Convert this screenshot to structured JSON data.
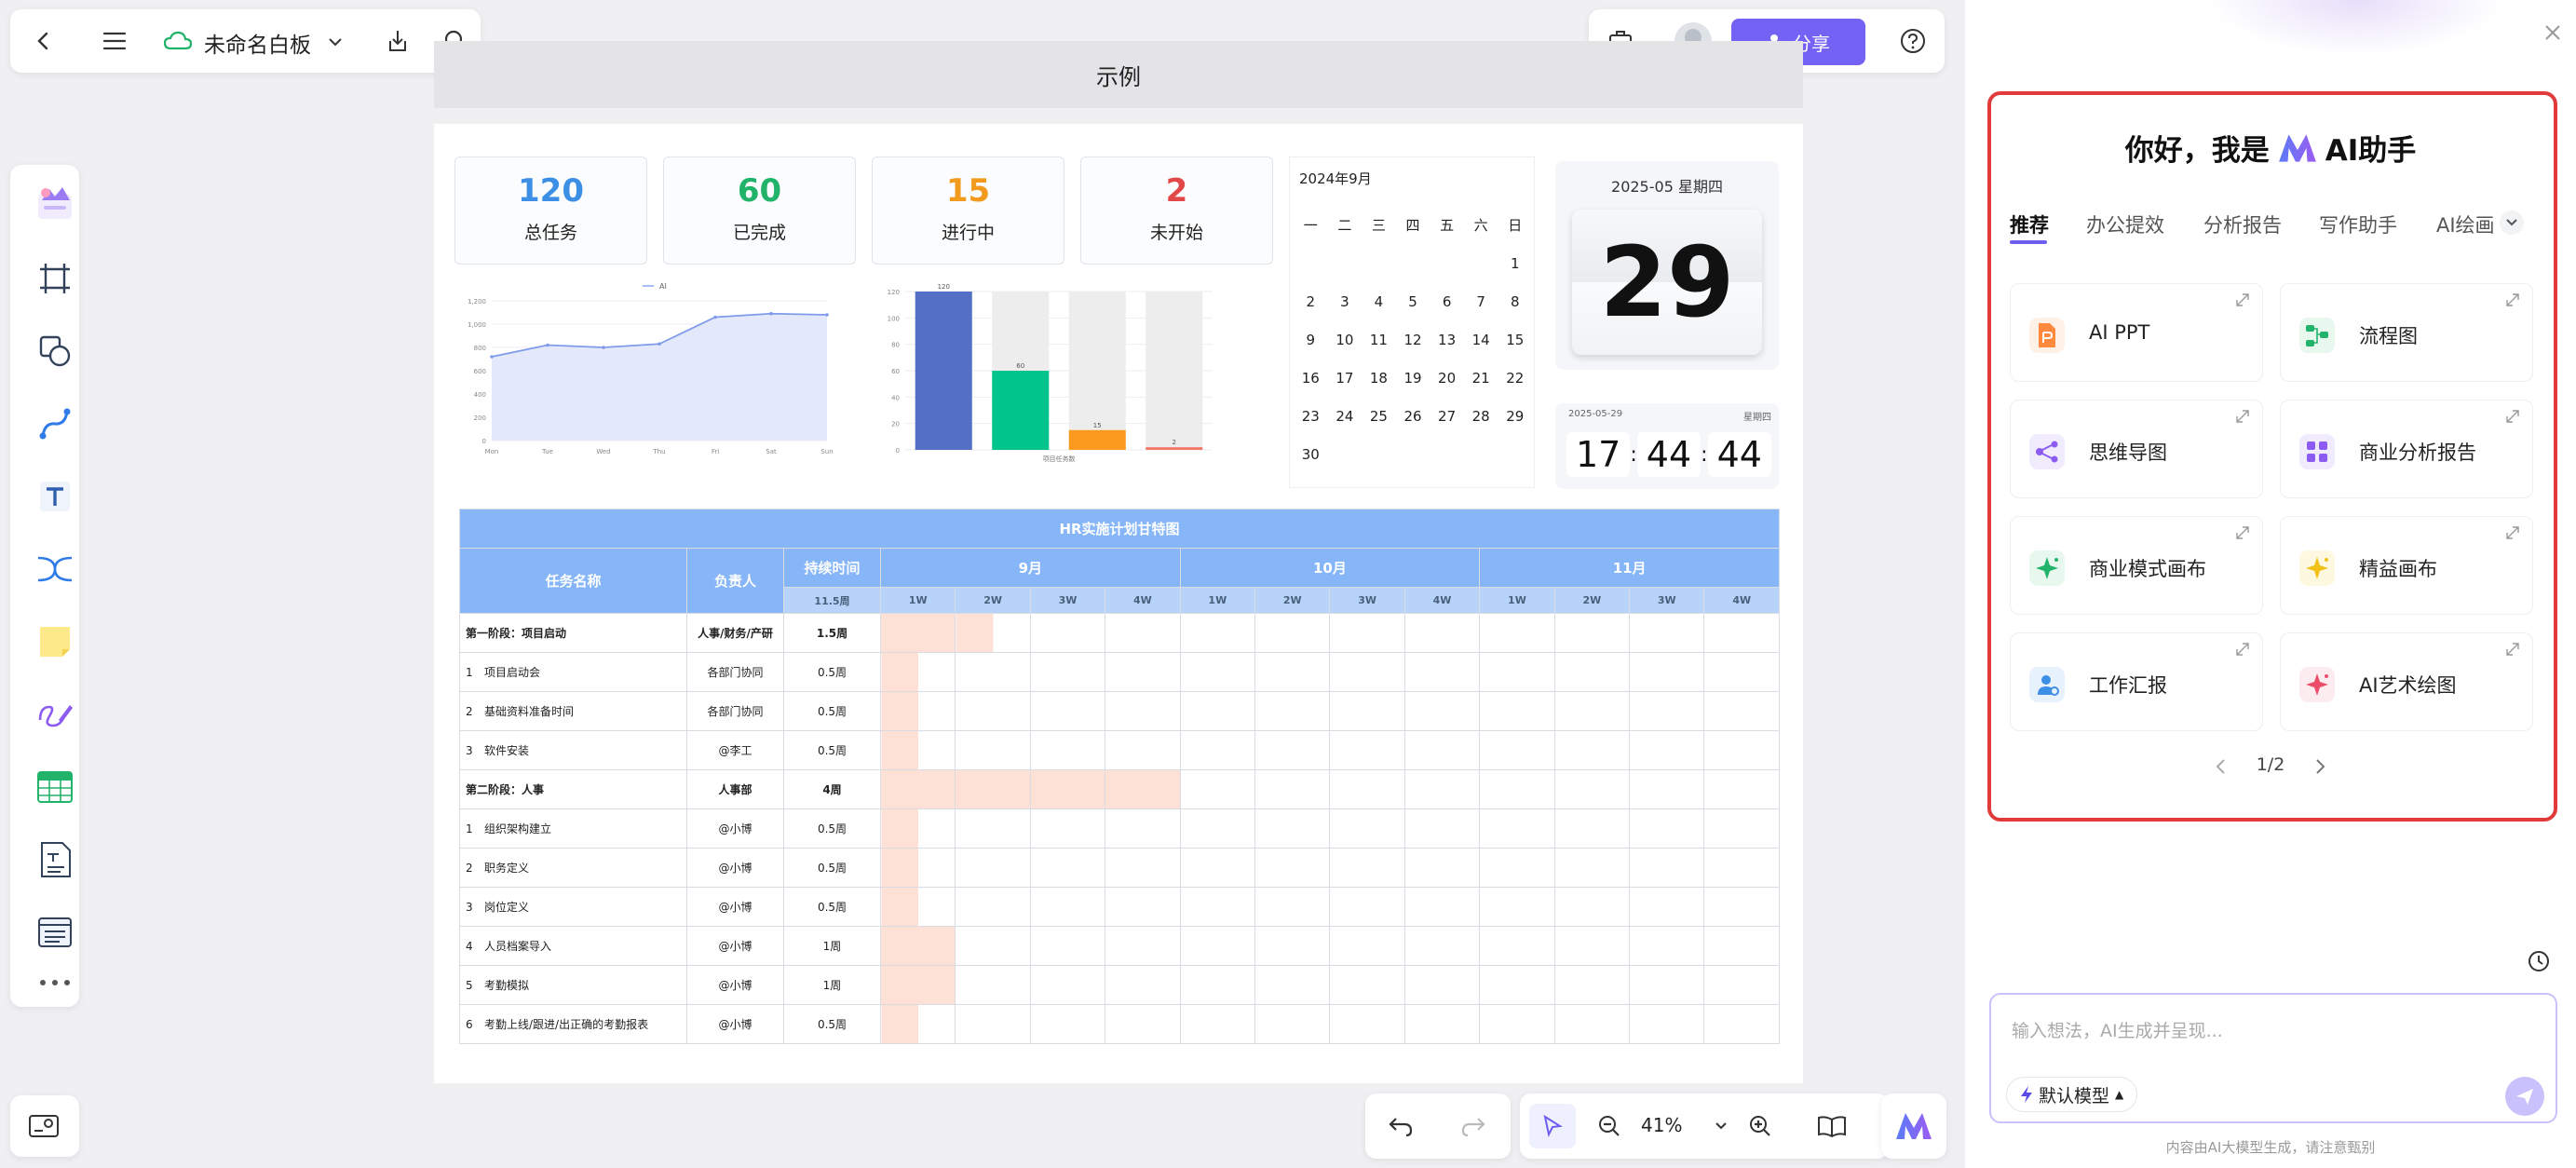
{
  "topbar": {
    "title": "未命名白板"
  },
  "header_right": {
    "share_label": "分享"
  },
  "board": {
    "title": "示例"
  },
  "stats": [
    {
      "value": "120",
      "label": "总任务",
      "color": "#3d8fe6"
    },
    {
      "value": "60",
      "label": "已完成",
      "color": "#22b36b"
    },
    {
      "value": "15",
      "label": "进行中",
      "color": "#f29a1d"
    },
    {
      "value": "2",
      "label": "未开始",
      "color": "#e34848"
    }
  ],
  "calendar": {
    "title": "2024年9月",
    "weekdays": [
      "一",
      "二",
      "三",
      "四",
      "五",
      "六",
      "日"
    ],
    "weeks": [
      [
        "",
        "",
        "",
        "",
        "",
        "",
        "1"
      ],
      [
        "2",
        "3",
        "4",
        "5",
        "6",
        "7",
        "8"
      ],
      [
        "9",
        "10",
        "11",
        "12",
        "13",
        "14",
        "15"
      ],
      [
        "16",
        "17",
        "18",
        "19",
        "20",
        "21",
        "22"
      ],
      [
        "23",
        "24",
        "25",
        "26",
        "27",
        "28",
        "29"
      ],
      [
        "30",
        "",
        "",
        "",
        "",
        "",
        ""
      ]
    ]
  },
  "flip_date": {
    "header": "2025-05 星期四",
    "day": "29"
  },
  "clock": {
    "date": "2025-05-29",
    "weekday": "星期四",
    "h": "17",
    "m": "44",
    "s": "44"
  },
  "chart_data": [
    {
      "type": "area",
      "legend": [
        "AI"
      ],
      "categories": [
        "Mon",
        "Tue",
        "Wed",
        "Thu",
        "Fri",
        "Sat",
        "Sun"
      ],
      "series": [
        {
          "name": "AI",
          "values": [
            720,
            820,
            800,
            830,
            1060,
            1090,
            1080
          ]
        }
      ],
      "ylim": [
        0,
        1200
      ],
      "yticks": [
        "0",
        "200",
        "400",
        "600",
        "800",
        "1,000",
        "1,200"
      ],
      "grid": true
    },
    {
      "type": "bar",
      "categories": [
        "",
        "",
        "",
        ""
      ],
      "values": [
        120,
        60,
        15,
        2
      ],
      "data_labels": [
        "120",
        "60",
        "15",
        "2"
      ],
      "colors": [
        "#5470c6",
        "#00c48c",
        "#fb9a1f",
        "#f7766a"
      ],
      "ylim": [
        0,
        120
      ],
      "yticks": [
        "0",
        "20",
        "40",
        "60",
        "80",
        "100",
        "120"
      ],
      "xlabel": "项目任务数",
      "background_bars": true
    }
  ],
  "gantt": {
    "title": "HR实施计划甘特图",
    "col_task": "任务名称",
    "col_owner": "负责人",
    "col_duration": "持续时间",
    "total_duration": "11.5周",
    "months": [
      "9月",
      "10月",
      "11月"
    ],
    "weeks": [
      "1W",
      "2W",
      "3W",
      "4W",
      "1W",
      "2W",
      "3W",
      "4W",
      "1W",
      "2W",
      "3W",
      "4W"
    ],
    "rows": [
      {
        "idx": "",
        "name": "第一阶段：项目启动",
        "owner": "人事/财务/产研",
        "dur": "1.5周",
        "bold": true,
        "start": 0,
        "len": 3
      },
      {
        "idx": "1",
        "name": "项目启动会",
        "owner": "各部门协同",
        "dur": "0.5周",
        "bold": false,
        "start": 0,
        "len": 1
      },
      {
        "idx": "2",
        "name": "基础资料准备时间",
        "owner": "各部门协同",
        "dur": "0.5周",
        "bold": false,
        "start": 0,
        "len": 1
      },
      {
        "idx": "3",
        "name": "软件安装",
        "owner": "@李工",
        "dur": "0.5周",
        "bold": false,
        "start": 0,
        "len": 1
      },
      {
        "idx": "",
        "name": "第二阶段：人事",
        "owner": "人事部",
        "dur": "4周",
        "bold": true,
        "start": 0,
        "len": 8
      },
      {
        "idx": "1",
        "name": "组织架构建立",
        "owner": "@小博",
        "dur": "0.5周",
        "bold": false,
        "start": 0,
        "len": 1
      },
      {
        "idx": "2",
        "name": "职务定义",
        "owner": "@小博",
        "dur": "0.5周",
        "bold": false,
        "start": 0,
        "len": 1
      },
      {
        "idx": "3",
        "name": "岗位定义",
        "owner": "@小博",
        "dur": "0.5周",
        "bold": false,
        "start": 0,
        "len": 1
      },
      {
        "idx": "4",
        "name": "人员档案导入",
        "owner": "@小博",
        "dur": "1周",
        "bold": false,
        "start": 0,
        "len": 2
      },
      {
        "idx": "5",
        "name": "考勤模拟",
        "owner": "@小博",
        "dur": "1周",
        "bold": false,
        "start": 0,
        "len": 2
      },
      {
        "idx": "6",
        "name": "考勤上线/跟进/出正确的考勤报表",
        "owner": "@小博",
        "dur": "0.5周",
        "bold": false,
        "start": 0,
        "len": 1
      }
    ]
  },
  "zoom": {
    "value": "41%"
  },
  "ai_panel": {
    "greeting_pre": "你好，我是",
    "greeting_post": "AI助手",
    "tabs": [
      "推荐",
      "办公提效",
      "分析报告",
      "写作助手",
      "AI绘画"
    ],
    "cards": [
      {
        "label": "AI PPT",
        "icon": "ppt-icon",
        "bg": "#fff1e6",
        "fg": "#ff8a3d"
      },
      {
        "label": "流程图",
        "icon": "flowchart-icon",
        "bg": "#e8f8ef",
        "fg": "#22b36b"
      },
      {
        "label": "思维导图",
        "icon": "mindmap-icon",
        "bg": "#f1ecfd",
        "fg": "#8c5cf2"
      },
      {
        "label": "商业分析报告",
        "icon": "report-icon",
        "bg": "#f1ecfd",
        "fg": "#8c5cf2"
      },
      {
        "label": "商业模式画布",
        "icon": "sparkle-icon",
        "bg": "#e8f8ef",
        "fg": "#22b36b"
      },
      {
        "label": "精益画布",
        "icon": "sparkle-icon",
        "bg": "#fff8e0",
        "fg": "#f2c21b"
      },
      {
        "label": "工作汇报",
        "icon": "person-report-icon",
        "bg": "#e8f2fd",
        "fg": "#3d8fe6"
      },
      {
        "label": "AI艺术绘图",
        "icon": "sparkle-icon",
        "bg": "#fdecef",
        "fg": "#ee4d6a"
      }
    ],
    "pagination": "1/2",
    "input_placeholder": "输入想法，AI生成并呈现...",
    "model_label": "默认模型",
    "disclaimer": "内容由AI大模型生成，请注意甄别",
    "accent": "#6e5ef0",
    "highlight": "#e03a3a"
  }
}
